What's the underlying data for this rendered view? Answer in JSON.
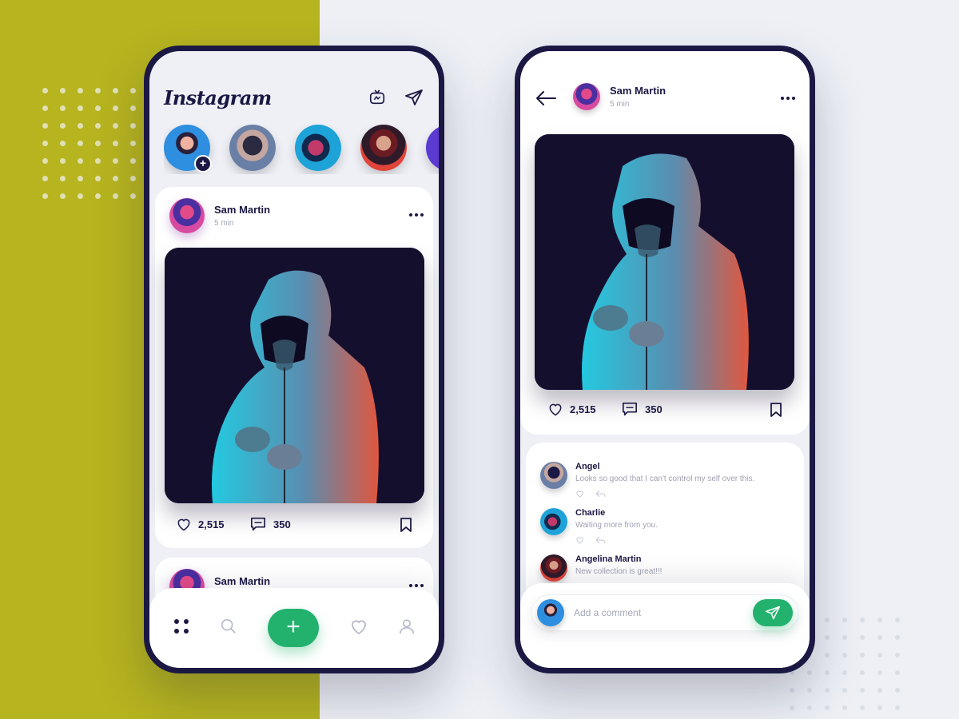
{
  "colors": {
    "accent": "#23b26d",
    "ink": "#1b1844",
    "olive": "#b6b41f",
    "muted": "#a4a8b8"
  },
  "feed": {
    "app_title": "Instagram",
    "header_icons": [
      "igtv-icon",
      "send-icon"
    ],
    "stories": [
      "story-own",
      "story-1",
      "story-2",
      "story-3",
      "story-4"
    ],
    "post": {
      "author": "Sam Martin",
      "time": "5 min",
      "likes": "2,515",
      "comments": "350"
    },
    "next_post": {
      "author": "Sam Martin"
    },
    "nav": [
      "grid-icon",
      "search-icon",
      "plus-icon",
      "heart-icon",
      "user-icon"
    ]
  },
  "detail": {
    "author": "Sam Martin",
    "time": "5 min",
    "likes": "2,515",
    "comments": "350",
    "comment_list": [
      {
        "name": "Angel",
        "text": "Looks so good that I can't control my self over this."
      },
      {
        "name": "Charlie",
        "text": "Waiting more from you."
      },
      {
        "name": "Angelina Martin",
        "text": "New collection is great!!!"
      }
    ],
    "comment_placeholder": "Add a comment"
  }
}
